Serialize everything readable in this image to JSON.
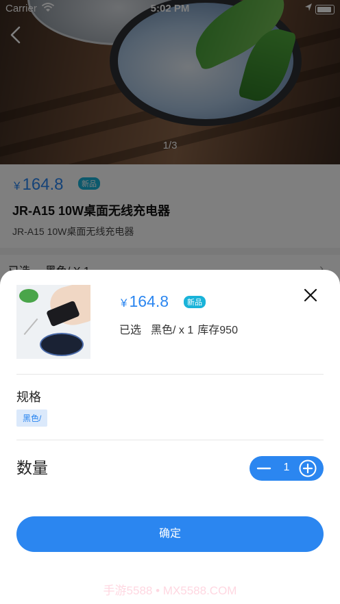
{
  "status_bar": {
    "carrier": "Carrier",
    "time": "5:02 PM"
  },
  "gallery": {
    "counter": "1/3"
  },
  "product": {
    "currency": "¥",
    "price": "164.8",
    "badge": "新品",
    "title": "JR-A15 10W桌面无线充电器",
    "subtitle": "JR-A15 10W桌面无线充电器"
  },
  "selection_row": {
    "label": "已选",
    "value": "黑色/ X 1"
  },
  "sheet": {
    "currency": "¥",
    "price": "164.8",
    "badge": "新品",
    "selected_label": "已选",
    "selected_value": "黑色/ x 1",
    "stock": "库存950",
    "spec_label": "规格",
    "spec_option": "黑色/",
    "qty_label": "数量",
    "qty_value": "1",
    "confirm_label": "确定"
  },
  "watermark": "手游5588 • MX5588.COM",
  "colors": {
    "accent": "#2b86f0",
    "badge": "#19b3d9",
    "chip_bg": "#dbe9fb"
  },
  "icons": [
    "wifi-icon",
    "location-icon",
    "battery-icon",
    "back-icon",
    "chevron-right-icon",
    "close-icon",
    "minus-icon",
    "plus-icon"
  ]
}
